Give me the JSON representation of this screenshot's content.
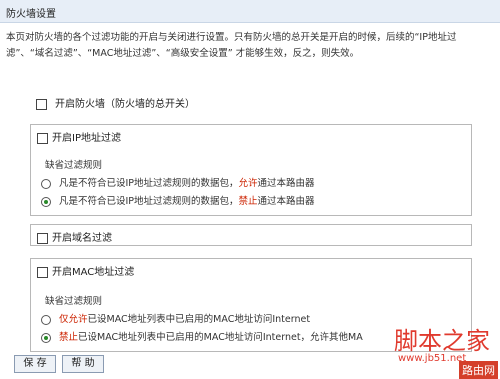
{
  "title": "防火墙设置",
  "description": "本页对防火墙的各个过滤功能的开启与关闭进行设置。只有防火墙的总开关是开启的时候，后续的“IP地址过滤”、“域名过滤”、“MAC地址过滤”、“高级安全设置” 才能够生效，反之，则失效。",
  "master_switch": {
    "label": "开启防火墙（防火墙的总开关）",
    "checked": false
  },
  "ip_filter": {
    "label": "开启IP地址过滤",
    "checked": false,
    "default_rule_label": "缺省过滤规则",
    "options": [
      {
        "prefix": "凡是不符合已设IP地址过滤规则的数据包，",
        "keyword": "允许",
        "suffix": "通过本路由器",
        "selected": false
      },
      {
        "prefix": "凡是不符合已设IP地址过滤规则的数据包，",
        "keyword": "禁止",
        "suffix": "通过本路由器",
        "selected": true
      }
    ]
  },
  "domain_filter": {
    "label": "开启域名过滤",
    "checked": false
  },
  "mac_filter": {
    "label": "开启MAC地址过滤",
    "checked": false,
    "default_rule_label": "缺省过滤规则",
    "options": [
      {
        "prefix": "",
        "keyword": "仅允许",
        "suffix": "已设MAC地址列表中已启用的MAC地址访问Internet",
        "selected": false
      },
      {
        "prefix": "",
        "keyword": "禁止",
        "suffix": "已设MAC地址列表中已启用的MAC地址访问Internet，允许其他MA",
        "selected": true
      }
    ]
  },
  "buttons": {
    "save": "保 存",
    "help": "帮 助"
  },
  "watermark": {
    "line1": "脚本之家",
    "line2": "www.jb51.net",
    "line3": "路由网"
  },
  "colors": {
    "accent_red": "#cc2200",
    "title_bg": "#e7eef7"
  }
}
